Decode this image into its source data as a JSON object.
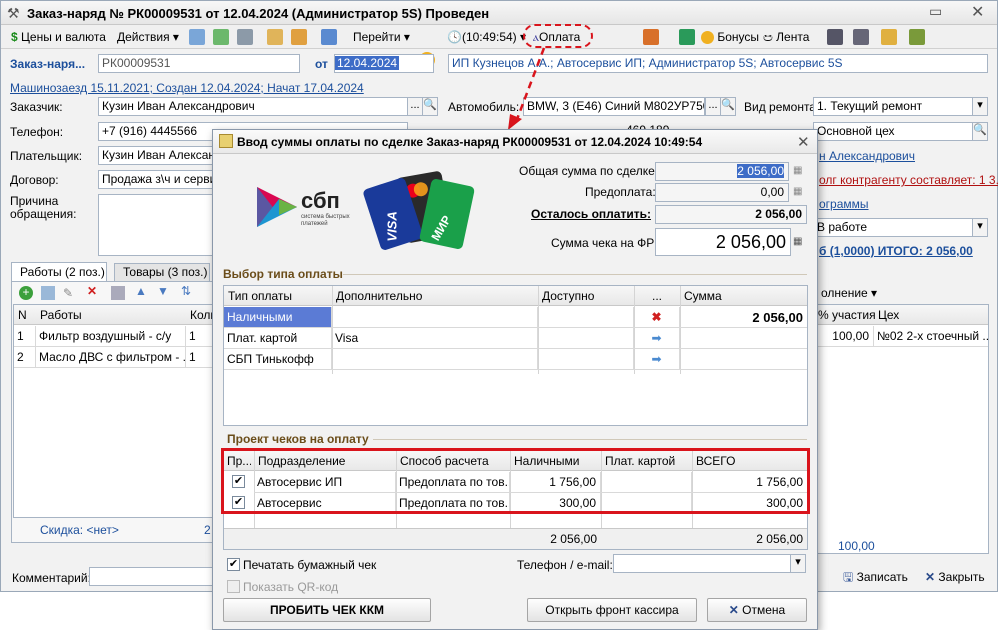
{
  "main": {
    "title": "Заказ-наряд № РК00009531 от 12.04.2024 (Администратор 5S) Проведен",
    "toolbar": {
      "prices": "Цены и валюта",
      "actions": "Действия",
      "goto": "Перейти",
      "time": "(10:49:54)",
      "payment": "Оплата",
      "bonuses": "Бонусы",
      "tape": "Лента"
    },
    "doc_label": "Заказ-наря...",
    "doc_number": "РК00009531",
    "from_label": "от",
    "doc_date": "12.04.2024",
    "org": "ИП Кузнецов А.А.; Автосервис ИП; Администратор 5S; Автосервис 5S",
    "history_link": "Машинозаезд 15.11.2021; Создан 12.04.2024; Начат 17.04.2024",
    "customer_label": "Заказчик:",
    "customer": "Кузин Иван Александрович",
    "phone_label": "Телефон:",
    "phone": "+7 (916) 4445566",
    "payer_label": "Плательщик:",
    "payer": "Кузин Иван Александ",
    "contract_label": "Договор:",
    "contract": "Продажа з\\ч и сервис",
    "reason_label": "Причина обращения:",
    "car_label": "Автомобиль:",
    "car": "BMW, 3 (E46) Синий М802УР750",
    "car_row2_value": "469 189",
    "repair_type_label": "Вид ремонта:",
    "repair_type": "1. Текущий ремонт",
    "shop": "Основной цех",
    "master_link": "н Александрович",
    "debt_link": "олг контрагенту составляет: 1 3...",
    "status": "В работе",
    "programs_link": "ограммы",
    "total_link": "б (1,0000) ИТОГО: 2 056,00",
    "tabs": [
      "Работы (2 поз.)",
      "Товары (3 поз.)"
    ],
    "works_headers": [
      "N",
      "Работы",
      "Коли"
    ],
    "works_rows": [
      {
        "n": "1",
        "name": "Фильтр воздушный - с/у",
        "qty": "1"
      },
      {
        "n": "2",
        "name": "Масло ДВС с фильтром - ...",
        "qty": "1"
      }
    ],
    "discount": "Скидка: <нет>",
    "discount_val": "2",
    "right_headers": [
      "олнение",
      "% участия",
      "Цех"
    ],
    "right_row": {
      "pct": "100,00",
      "shop": "№02  2-х стоечный ..."
    },
    "right_total": "100,00",
    "comment_label": "Комментарий:",
    "save_label": "Записать",
    "close_label": "Закрыть"
  },
  "dialog": {
    "title": "Ввод суммы оплаты по сделке Заказ-наряд РК00009531 от 12.04.2024 10:49:54",
    "sbp_text": "сбп",
    "sbp_sub": "система быстрых платежей",
    "card_visa": "VISA",
    "card_mir": "МИР",
    "total_label": "Общая сумма по сделке:",
    "total": "2 056,00",
    "prepay_label": "Предоплата:",
    "prepay": "0,00",
    "remaining_label": "Осталось оплатить:",
    "remaining": "2 056,00",
    "receipt_label": "Сумма чека на ФР:",
    "receipt": "2 056,00",
    "pay_section": "Выбор типа оплаты",
    "pay_headers": [
      "Тип оплаты",
      "Дополнительно",
      "Доступно",
      "...",
      "Сумма"
    ],
    "pay_rows": [
      {
        "type": "Наличными",
        "extra": "",
        "sum": "2 056,00"
      },
      {
        "type": "Плат. картой",
        "extra": "Visa",
        "sum": ""
      },
      {
        "type": "СБП Тинькофф",
        "extra": "",
        "sum": ""
      }
    ],
    "checks_section": "Проект чеков на оплату",
    "checks_headers": [
      "Пр...",
      "Подразделение",
      "Способ расчета",
      "Наличными",
      "Плат. картой",
      "ВСЕГО"
    ],
    "checks_rows": [
      {
        "dept": "Автосервис ИП",
        "method": "Предоплата по тов...",
        "cash": "1 756,00",
        "card": "",
        "total": "1 756,00"
      },
      {
        "dept": "Автосервис",
        "method": "Предоплата по тов...",
        "cash": "300,00",
        "card": "",
        "total": "300,00"
      }
    ],
    "checks_footer_cash": "2 056,00",
    "checks_footer_total": "2 056,00",
    "print_paper": "Печатать бумажный чек",
    "show_qr": "Показать QR-код",
    "phone_label": "Телефон / e-mail:",
    "btn_print": "ПРОБИТЬ ЧЕК ККМ",
    "btn_front": "Открыть фронт кассира",
    "btn_cancel": "Отмена"
  },
  "colors": {
    "highlight_red": "#d9141c",
    "link_blue": "#1c4f9c",
    "selected_row": "#5b7bd5",
    "section_brown": "#6b4d1a"
  }
}
